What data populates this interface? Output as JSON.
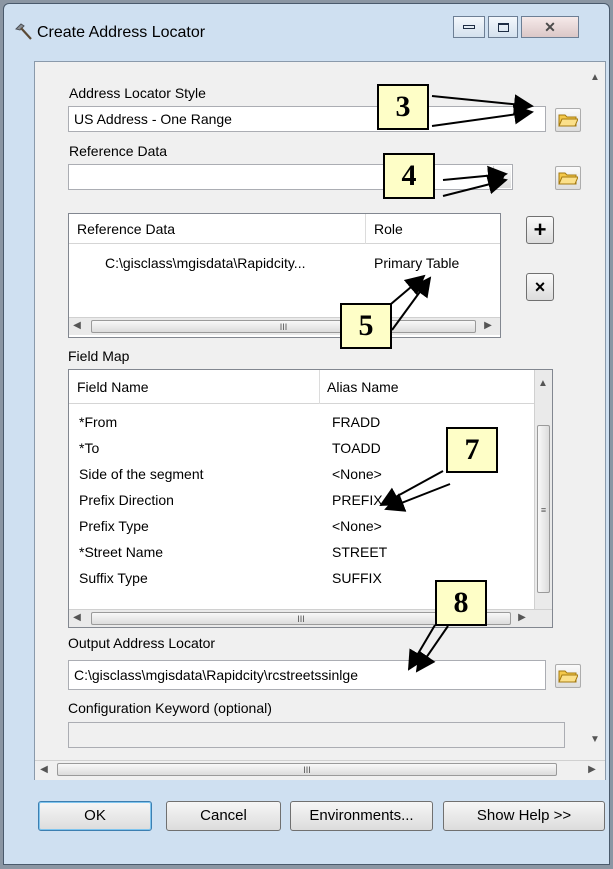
{
  "window": {
    "title": "Create Address Locator",
    "icon": "hammer-icon",
    "controls": {
      "minimize": "minimize-icon",
      "maximize": "maximize-icon",
      "close": "close-icon"
    }
  },
  "locator_style": {
    "label": "Address Locator Style",
    "value": "US Address - One Range"
  },
  "reference_data": {
    "label": "Reference Data",
    "value": "",
    "table": {
      "headers": [
        "Reference Data",
        "Role"
      ],
      "rows": [
        {
          "data": "C:\\gisclass\\mgisdata\\Rapidcity...",
          "role": "Primary Table"
        }
      ]
    }
  },
  "field_map": {
    "label": "Field Map",
    "headers": [
      "Field Name",
      "Alias Name"
    ],
    "rows": [
      {
        "field": "*From",
        "alias": "FRADD"
      },
      {
        "field": "*To",
        "alias": "TOADD"
      },
      {
        "field": "Side of the segment",
        "alias": "<None>"
      },
      {
        "field": "Prefix Direction",
        "alias": "PREFIX"
      },
      {
        "field": "Prefix Type",
        "alias": "<None>"
      },
      {
        "field": "*Street Name",
        "alias": "STREET"
      },
      {
        "field": "Suffix Type",
        "alias": "SUFFIX"
      }
    ]
  },
  "output": {
    "label": "Output Address Locator",
    "value": "C:\\gisclass\\mgisdata\\Rapidcity\\rcstreetssinlge"
  },
  "config": {
    "label": "Configuration Keyword (optional)",
    "value": ""
  },
  "scroll_thumb_text": "III",
  "buttons": {
    "ok": "OK",
    "cancel": "Cancel",
    "environments": "Environments...",
    "help": "Show Help >>"
  },
  "side_buttons": {
    "add": "+",
    "remove": "×"
  },
  "callouts": [
    "3",
    "4",
    "5",
    "7",
    "8"
  ],
  "colors": {
    "callout_fill": "#fefec7",
    "frame": "#cfe0f1",
    "dialog": "#f0f0f0"
  }
}
